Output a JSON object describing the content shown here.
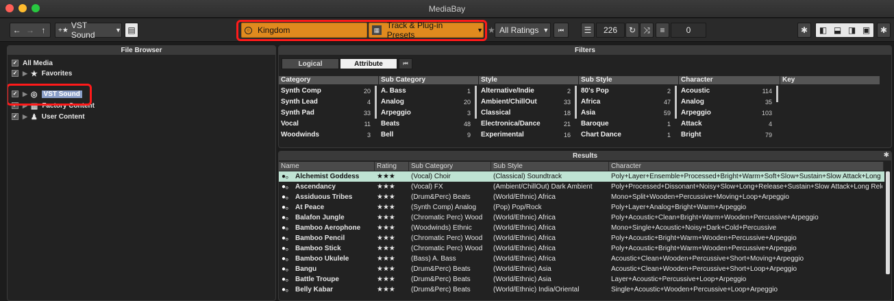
{
  "window": {
    "title": "MediaBay"
  },
  "toolbar": {
    "location_label": "VST Sound",
    "search_value": "Kingdom",
    "content_filter": "Track & Plug-in Presets",
    "rating_filter": "All Ratings",
    "result_count": "226",
    "secondary_count": "0"
  },
  "file_browser": {
    "title": "File Browser",
    "items": [
      {
        "label": "All Media",
        "indent": 0
      },
      {
        "label": "Favorites",
        "indent": 1
      },
      {
        "label": "VST Sound",
        "indent": 1,
        "selected": true
      },
      {
        "label": "Factory Content",
        "indent": 1
      },
      {
        "label": "User Content",
        "indent": 1
      }
    ]
  },
  "filters": {
    "title": "Filters",
    "tab_logical": "Logical",
    "tab_attribute": "Attribute",
    "columns": [
      {
        "header": "Category",
        "items": [
          [
            "Synth Comp",
            "20"
          ],
          [
            "Synth Lead",
            "4"
          ],
          [
            "Synth Pad",
            "33"
          ],
          [
            "Vocal",
            "11"
          ],
          [
            "Woodwinds",
            "3"
          ]
        ]
      },
      {
        "header": "Sub Category",
        "items": [
          [
            "A. Bass",
            "1"
          ],
          [
            "Analog",
            "20"
          ],
          [
            "Arpeggio",
            "3"
          ],
          [
            "Beats",
            "48"
          ],
          [
            "Bell",
            "9"
          ]
        ]
      },
      {
        "header": "Style",
        "items": [
          [
            "Alternative/Indie",
            "2"
          ],
          [
            "Ambient/ChillOut",
            "33"
          ],
          [
            "Classical",
            "18"
          ],
          [
            "Electronica/Dance",
            "21"
          ],
          [
            "Experimental",
            "16"
          ]
        ]
      },
      {
        "header": "Sub Style",
        "items": [
          [
            "80's Pop",
            "2"
          ],
          [
            "Africa",
            "47"
          ],
          [
            "Asia",
            "59"
          ],
          [
            "Baroque",
            "1"
          ],
          [
            "Chart Dance",
            "1"
          ]
        ]
      },
      {
        "header": "Character",
        "items": [
          [
            "Acoustic",
            "114"
          ],
          [
            "Analog",
            "35"
          ],
          [
            "Arpeggio",
            "103"
          ],
          [
            "Attack",
            "4"
          ],
          [
            "Bright",
            "79"
          ]
        ]
      },
      {
        "header": "Key",
        "items": []
      }
    ]
  },
  "results": {
    "title": "Results",
    "headers": {
      "name": "Name",
      "rating": "Rating",
      "sub_category": "Sub Category",
      "sub_style": "Sub Style",
      "character": "Character"
    },
    "rows": [
      {
        "name": "Alchemist Goddess",
        "rating": "★★★",
        "sub_category": "(Vocal) Choir",
        "sub_style": "(Classical) Soundtrack",
        "character": "Poly+Layer+Ensemble+Processed+Bright+Warm+Soft+Slow+Sustain+Slow Attack+Long Releas"
      },
      {
        "name": "Ascendancy",
        "rating": "★★★",
        "sub_category": "(Vocal) FX",
        "sub_style": "(Ambient/ChillOut) Dark Ambient",
        "character": "Poly+Processed+Dissonant+Noisy+Slow+Long+Release+Sustain+Slow Attack+Long Release+M"
      },
      {
        "name": "Assiduous Tribes",
        "rating": "★★★",
        "sub_category": "(Drum&Perc) Beats",
        "sub_style": "(World/Ethnic) Africa",
        "character": "Mono+Split+Wooden+Percussive+Moving+Loop+Arpeggio"
      },
      {
        "name": "At Peace",
        "rating": "★★★",
        "sub_category": "(Synth Comp) Analog",
        "sub_style": "(Pop) Pop/Rock",
        "character": "Poly+Layer+Analog+Bright+Warm+Arpeggio"
      },
      {
        "name": "Balafon Jungle",
        "rating": "★★★",
        "sub_category": "(Chromatic Perc) Wood",
        "sub_style": "(World/Ethnic) Africa",
        "character": "Poly+Acoustic+Clean+Bright+Warm+Wooden+Percussive+Arpeggio"
      },
      {
        "name": "Bamboo Aerophone",
        "rating": "★★★",
        "sub_category": "(Woodwinds) Ethnic",
        "sub_style": "(World/Ethnic) Africa",
        "character": "Mono+Single+Acoustic+Noisy+Dark+Cold+Percussive"
      },
      {
        "name": "Bamboo Pencil",
        "rating": "★★★",
        "sub_category": "(Chromatic Perc) Wood",
        "sub_style": "(World/Ethnic) Africa",
        "character": "Poly+Acoustic+Bright+Warm+Wooden+Percussive+Arpeggio"
      },
      {
        "name": "Bamboo Stick",
        "rating": "★★★",
        "sub_category": "(Chromatic Perc) Wood",
        "sub_style": "(World/Ethnic) Africa",
        "character": "Poly+Acoustic+Bright+Warm+Wooden+Percussive+Arpeggio"
      },
      {
        "name": "Bamboo Ukulele",
        "rating": "★★★",
        "sub_category": "(Bass) A. Bass",
        "sub_style": "(World/Ethnic) Africa",
        "character": "Acoustic+Clean+Wooden+Percussive+Short+Moving+Arpeggio"
      },
      {
        "name": "Bangu",
        "rating": "★★★",
        "sub_category": "(Drum&Perc) Beats",
        "sub_style": "(World/Ethnic) Asia",
        "character": "Acoustic+Clean+Wooden+Percussive+Short+Loop+Arpeggio"
      },
      {
        "name": "Battle Troupe",
        "rating": "★★★",
        "sub_category": "(Drum&Perc) Beats",
        "sub_style": "(World/Ethnic) Asia",
        "character": "Layer+Acoustic+Percussive+Loop+Arpeggio"
      },
      {
        "name": "Belly Kabar",
        "rating": "★★★",
        "sub_category": "(Drum&Perc) Beats",
        "sub_style": "(World/Ethnic) India/Oriental",
        "character": "Single+Acoustic+Wooden+Percussive+Loop+Arpeggio"
      }
    ]
  },
  "colors": {
    "accent": "#e08a1e",
    "selection": "#bfe3d3",
    "highlight": "#ff1a1a"
  }
}
